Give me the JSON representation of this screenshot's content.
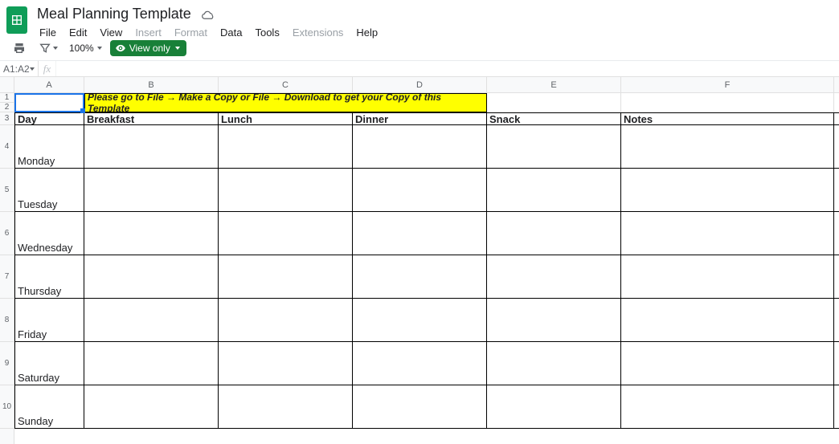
{
  "doc_title": "Meal Planning Template",
  "menus": {
    "file": "File",
    "edit": "Edit",
    "view": "View",
    "insert": "Insert",
    "format": "Format",
    "data": "Data",
    "tools": "Tools",
    "extensions": "Extensions",
    "help": "Help"
  },
  "toolbar": {
    "zoom": "100%",
    "view_only": "View only"
  },
  "namebox": "A1:A2",
  "fx_label": "fx",
  "columns": [
    "A",
    "B",
    "C",
    "D",
    "E",
    "F"
  ],
  "row_numbers": [
    "1",
    "2",
    "3",
    "4",
    "5",
    "6",
    "7",
    "8",
    "9",
    "10"
  ],
  "banner": "Please go to File → Make a Copy or File → Download to get your Copy of this Template",
  "headers": {
    "day": "Day",
    "breakfast": "Breakfast",
    "lunch": "Lunch",
    "dinner": "Dinner",
    "snack": "Snack",
    "notes": "Notes"
  },
  "days": {
    "mon": "Monday",
    "tue": "Tuesday",
    "wed": "Wednesday",
    "thu": "Thursday",
    "fri": "Friday",
    "sat": "Saturday",
    "sun": "Sunday"
  },
  "row_heights": {
    "r1": 12,
    "r2": 12,
    "r3": 14,
    "data": 54
  }
}
